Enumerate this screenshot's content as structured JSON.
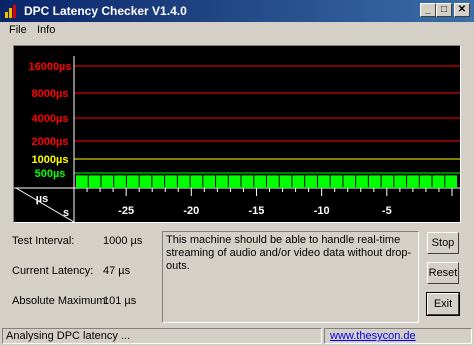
{
  "window": {
    "title": "DPC Latency Checker V1.4.0"
  },
  "menu": {
    "file_label": "File",
    "info_label": "Info"
  },
  "chart_data": {
    "type": "line",
    "title": "",
    "y_gridlines": [
      {
        "label": "16000µs",
        "value": 16000,
        "color": "#ff0000"
      },
      {
        "label": "8000µs",
        "value": 8000,
        "color": "#ff0000"
      },
      {
        "label": "4000µs",
        "value": 4000,
        "color": "#ff0000"
      },
      {
        "label": "2000µs",
        "value": 2000,
        "color": "#ff0000"
      },
      {
        "label": "1000µs",
        "value": 1000,
        "color": "#ffff00"
      },
      {
        "label": "500µs",
        "value": 500,
        "color": "#00ff00"
      }
    ],
    "yunit": "µs",
    "xunit": "s",
    "x_ticks": [
      "-25",
      "-20",
      "-15",
      "-10",
      "-5"
    ],
    "xlim": [
      -29,
      0
    ],
    "series": [
      {
        "color": "#00ff00",
        "values": [
          47,
          47,
          47,
          47,
          47,
          47,
          47,
          47,
          47,
          47,
          47,
          47,
          47,
          47,
          47,
          47,
          47,
          47,
          47,
          47,
          47,
          47,
          47,
          47,
          47,
          47,
          47,
          47,
          47,
          47
        ]
      }
    ]
  },
  "stats": {
    "test_interval_label": "Test Interval:",
    "test_interval_value": "1000 µs",
    "current_latency_label": "Current Latency:",
    "current_latency_value": "47 µs",
    "absolute_maximum_label": "Absolute Maximum:",
    "absolute_maximum_value": "101 µs"
  },
  "message": "This machine should be able to handle real-time streaming of audio and/or video data without drop-outs.",
  "buttons": {
    "stop": "Stop",
    "reset": "Reset",
    "exit": "Exit"
  },
  "status": {
    "text": "Analysing DPC latency ...",
    "link": "www.thesycon.de"
  }
}
